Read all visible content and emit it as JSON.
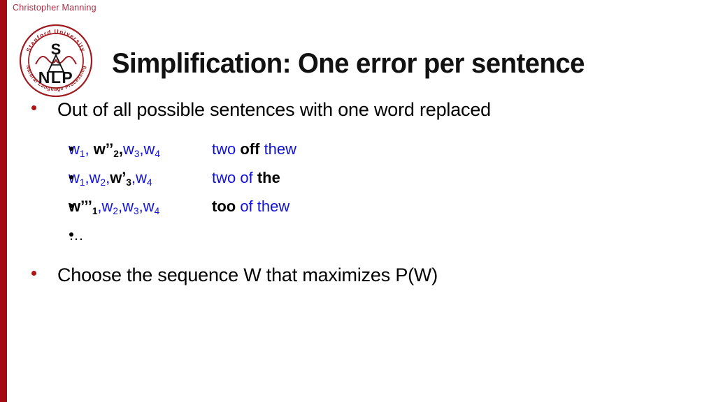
{
  "slide": {
    "presenter": "Christopher Manning",
    "title": "Simplification: One error per sentence",
    "accent_color": "#a30a12",
    "bullet_color": "#b21212",
    "highlight_color": "#1111dd"
  },
  "logo": {
    "name": "stanford-nlp-seal-icon",
    "outer_text_top": "Stanford University",
    "outer_text_bottom": "Natural Language Processing",
    "letter_top": "S",
    "letters_bottom": "N L P"
  },
  "content": {
    "bullet_1": "Out of all possible sentences with one word replaced",
    "bullet_2": "Choose the sequence W that maximizes P(W)",
    "candidates": [
      {
        "code": [
          {
            "text": "w",
            "sub": "1",
            "color": "blue",
            "bold": false
          },
          {
            "text": ", ",
            "sub": "",
            "color": "blue",
            "bold": false
          },
          {
            "text": "w’’",
            "sub": "2",
            "color": "black",
            "bold": true
          },
          {
            "text": ",",
            "sub": "",
            "color": "black",
            "bold": true
          },
          {
            "text": "w",
            "sub": "3",
            "color": "blue",
            "bold": false
          },
          {
            "text": ",",
            "sub": "",
            "color": "blue",
            "bold": false
          },
          {
            "text": "w",
            "sub": "4",
            "color": "blue",
            "bold": false
          }
        ],
        "gloss": [
          {
            "text": "two ",
            "color": "blue",
            "bold": false
          },
          {
            "text": "off",
            "color": "black",
            "bold": true
          },
          {
            "text": " thew",
            "color": "blue",
            "bold": false
          }
        ]
      },
      {
        "code": [
          {
            "text": "w",
            "sub": "1",
            "color": "blue",
            "bold": false
          },
          {
            "text": ",",
            "sub": "",
            "color": "blue",
            "bold": false
          },
          {
            "text": "w",
            "sub": "2",
            "color": "blue",
            "bold": false
          },
          {
            "text": ",",
            "sub": "",
            "color": "blue",
            "bold": false
          },
          {
            "text": "w’",
            "sub": "3",
            "color": "black",
            "bold": true
          },
          {
            "text": ",",
            "sub": "",
            "color": "blue",
            "bold": false
          },
          {
            "text": "w",
            "sub": "4",
            "color": "blue",
            "bold": false
          }
        ],
        "gloss": [
          {
            "text": "two of ",
            "color": "blue",
            "bold": false
          },
          {
            "text": "the",
            "color": "black",
            "bold": true
          }
        ]
      },
      {
        "code": [
          {
            "text": "w’’’",
            "sub": "1",
            "color": "black",
            "bold": true
          },
          {
            "text": ",",
            "sub": "",
            "color": "blue",
            "bold": false
          },
          {
            "text": "w",
            "sub": "2",
            "color": "blue",
            "bold": false
          },
          {
            "text": ",",
            "sub": "",
            "color": "blue",
            "bold": false
          },
          {
            "text": "w",
            "sub": "3",
            "color": "blue",
            "bold": false
          },
          {
            "text": ",",
            "sub": "",
            "color": "blue",
            "bold": false
          },
          {
            "text": "w",
            "sub": "4",
            "color": "blue",
            "bold": false
          }
        ],
        "gloss": [
          {
            "text": "too",
            "color": "black",
            "bold": true
          },
          {
            "text": " of thew",
            "color": "blue",
            "bold": false
          }
        ]
      }
    ],
    "ellipsis": "…"
  }
}
